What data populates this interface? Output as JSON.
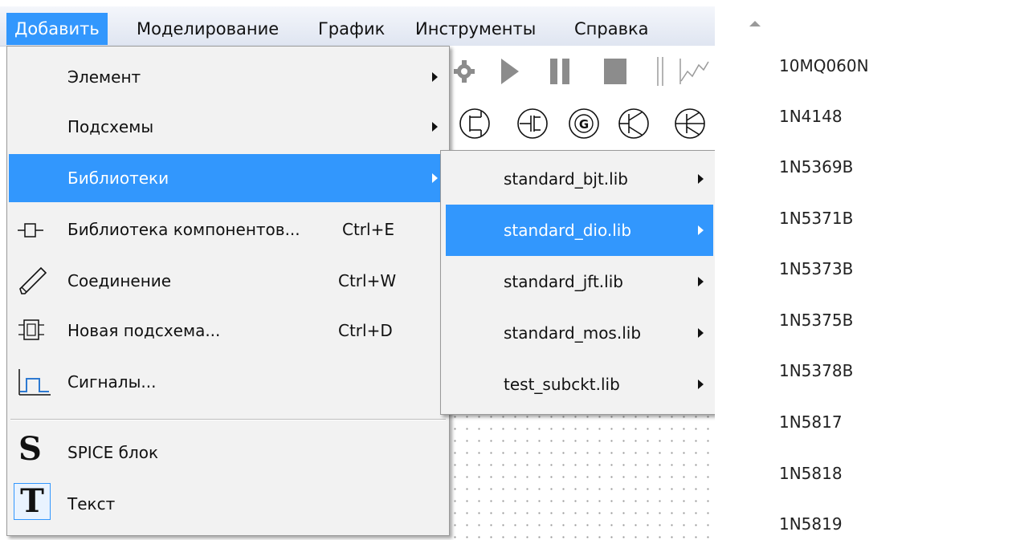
{
  "menubar": {
    "items": [
      {
        "label": "Добавить"
      },
      {
        "label": "Моделирование"
      },
      {
        "label": "График"
      },
      {
        "label": "Инструменты"
      },
      {
        "label": "Справка"
      }
    ]
  },
  "add_menu": {
    "items": [
      {
        "label": "Элемент",
        "submenu": true
      },
      {
        "label": "Подсхемы",
        "submenu": true
      },
      {
        "label": "Библиотеки",
        "submenu": true,
        "highlighted": true
      },
      {
        "label": "Библиотека компонентов...",
        "shortcut": "Ctrl+E",
        "icon": "component-icon"
      },
      {
        "label": "Соединение",
        "shortcut": "Ctrl+W",
        "icon": "pencil-icon"
      },
      {
        "label": "Новая подсхема...",
        "shortcut": "Ctrl+D",
        "icon": "subcircuit-icon"
      },
      {
        "label": "Сигналы...",
        "icon": "signal-icon"
      },
      {
        "label": "SPICE блок",
        "icon": "spice-block-icon",
        "icon_text": "S"
      },
      {
        "label": "Текст",
        "icon": "text-icon",
        "icon_text": "T"
      }
    ]
  },
  "libraries_submenu": {
    "items": [
      {
        "label": "standard_bjt.lib"
      },
      {
        "label": "standard_dio.lib",
        "highlighted": true
      },
      {
        "label": "standard_jft.lib"
      },
      {
        "label": "standard_mos.lib"
      },
      {
        "label": "test_subckt.lib"
      }
    ]
  },
  "diode_list": {
    "items": [
      "10MQ060N",
      "1N4148",
      "1N5369B",
      "1N5371B",
      "1N5373B",
      "1N5375B",
      "1N5378B",
      "1N5817",
      "1N5818",
      "1N5819"
    ]
  },
  "colors": {
    "highlight": "#3297fd",
    "menu_bg": "#f2f2f2",
    "toolbar_icon": "#8c8c8c"
  }
}
